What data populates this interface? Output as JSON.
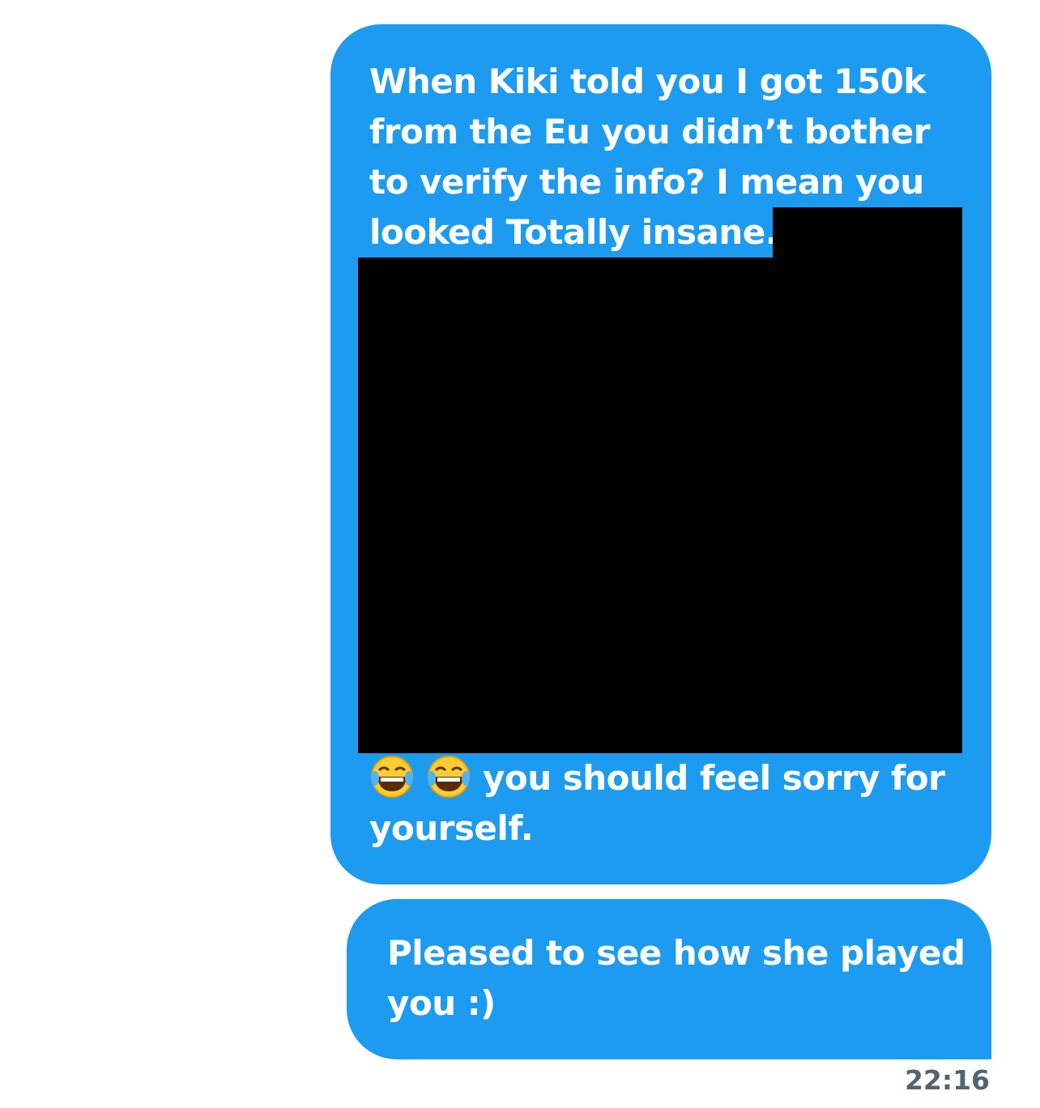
{
  "messages": [
    {
      "text_top": "When Kiki told you I got 150k\nfrom the Eu you didn’t bother\nto verify the info? I mean you\nlooked Totally insane.",
      "emojis": [
        "😂",
        "😂"
      ],
      "text_bottom": "you should feel sorry for\nyourself."
    },
    {
      "text": "Pleased to see how she played\nyou :)"
    }
  ],
  "timestamp": "22:16",
  "colors": {
    "bubble": "#1d9bf0",
    "text": "#ffffff",
    "timestamp": "#536471",
    "redaction": "#000000"
  }
}
